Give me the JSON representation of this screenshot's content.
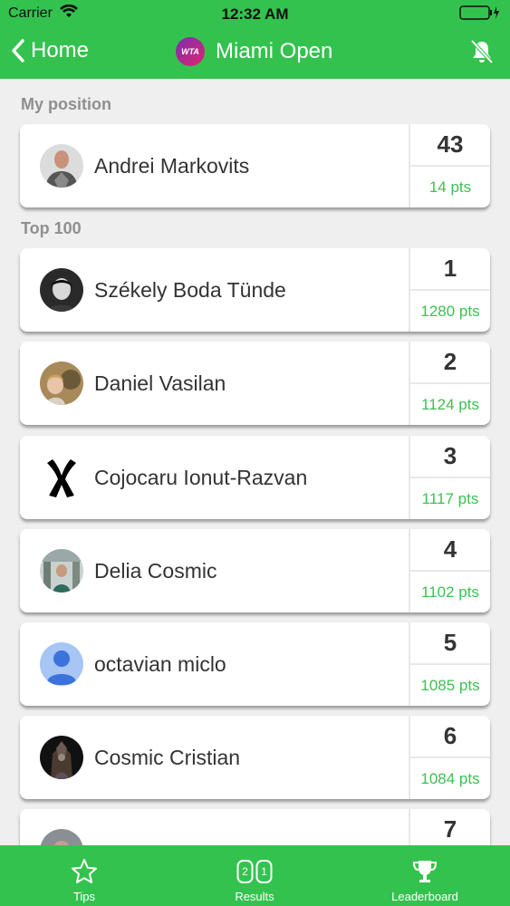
{
  "status": {
    "carrier": "Carrier",
    "time": "12:32 AM"
  },
  "nav": {
    "back_label": "Home",
    "title": "Miami Open",
    "logo_text": "WTA"
  },
  "sections": {
    "my_position": "My position",
    "top100": "Top 100"
  },
  "my_position": {
    "name": "Andrei Markovits",
    "rank": "43",
    "pts": "14 pts"
  },
  "players": [
    {
      "name": "Székely Boda Tünde",
      "rank": "1",
      "pts": "1280 pts"
    },
    {
      "name": "Daniel Vasilan",
      "rank": "2",
      "pts": "1124 pts"
    },
    {
      "name": "Cojocaru Ionut-Razvan",
      "rank": "3",
      "pts": "1117 pts"
    },
    {
      "name": "Delia Cosmic",
      "rank": "4",
      "pts": "1102 pts"
    },
    {
      "name": "octavian miclo",
      "rank": "5",
      "pts": "1085 pts"
    },
    {
      "name": "Cosmic Cristian",
      "rank": "6",
      "pts": "1084 pts"
    },
    {
      "name": "",
      "rank": "7",
      "pts": ""
    }
  ],
  "tabs": {
    "tips": "Tips",
    "results": "Results",
    "leaderboard": "Leaderboard",
    "results_digit1": "2",
    "results_digit2": "1"
  },
  "colors": {
    "accent": "#34c24f",
    "points": "#3cc152"
  }
}
